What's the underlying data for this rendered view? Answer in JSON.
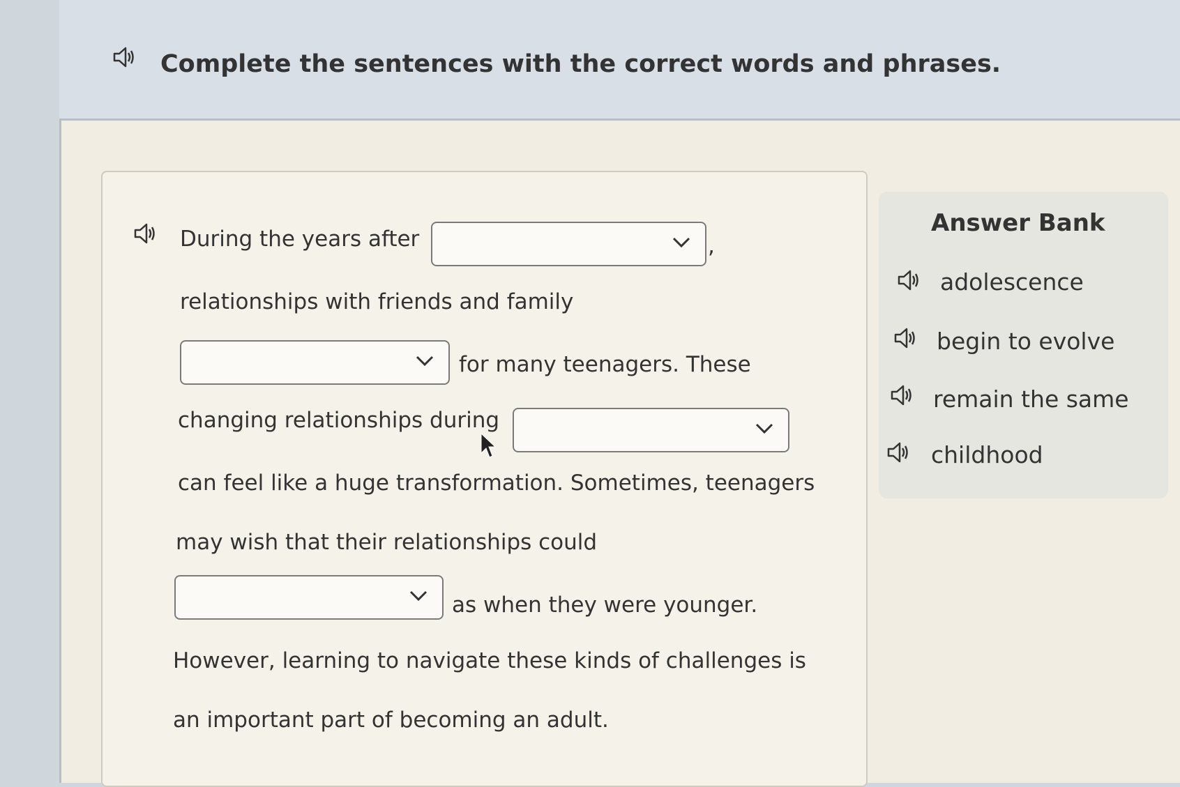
{
  "instructions": "Complete the sentences with the correct words and phrases.",
  "passage": {
    "line1": "During the years after",
    "line1_end": ",",
    "line2": "relationships with friends and family",
    "line3": "for many teenagers. These",
    "line4": "changing relationships during",
    "line5": "can feel like a huge transformation. Sometimes, teenagers",
    "line6": "may wish that their relationships could",
    "line7": "as when they were younger.",
    "line8": "However, learning to navigate these kinds of challenges is",
    "line9": "an important part of becoming an adult."
  },
  "dropdowns": [
    {
      "value": ""
    },
    {
      "value": ""
    },
    {
      "value": ""
    },
    {
      "value": ""
    }
  ],
  "answer_bank": {
    "title": "Answer Bank",
    "items": [
      "adolescence",
      "begin to evolve",
      "remain the same",
      "childhood"
    ]
  },
  "icons": {
    "speaker": "speaker-icon",
    "chevron": "chevron-down-icon",
    "cursor": "mouse-cursor-icon"
  }
}
